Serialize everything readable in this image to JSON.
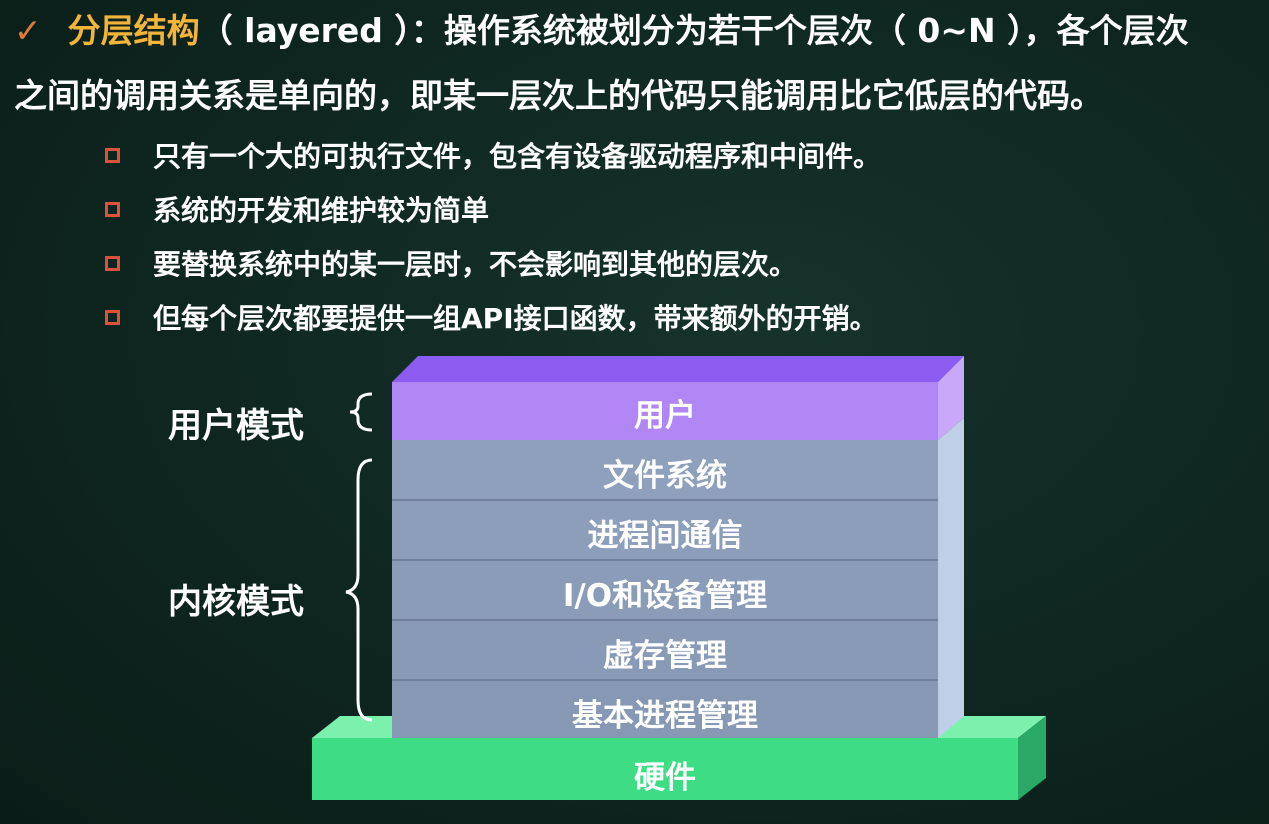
{
  "header": {
    "check_icon": "✓",
    "term": "分层结构",
    "term_rest": "（ layered ）：操作系统被划分为若干个层次（ 0~N ），各个层次",
    "line2": "之间的调用关系是单向的，即某一层次上的代码只能调用比它低层的代码。"
  },
  "bullets": [
    "只有一个大的可执行文件，包含有设备驱动程序和中间件。",
    "系统的开发和维护较为简单",
    "要替换系统中的某一层时，不会影响到其他的层次。",
    "但每个层次都要提供一组API接口函数，带来额外的开销。"
  ],
  "modes": {
    "user": "用户模式",
    "kernel": "内核模式"
  },
  "layers": {
    "user": "用户",
    "file_system": "文件系统",
    "ipc": "进程间通信",
    "io": "I/O和设备管理",
    "vm": "虚存管理",
    "process": "基本进程管理",
    "hardware": "硬件"
  },
  "colors": {
    "accent_term": "#f2b53a",
    "check": "#e07a3a",
    "bullet_marker": "#d9533c",
    "user_layer": "#b086f4",
    "kernel_layer": "#8fa0bd",
    "hardware": "#3fdc86",
    "background": "#0f2620"
  }
}
